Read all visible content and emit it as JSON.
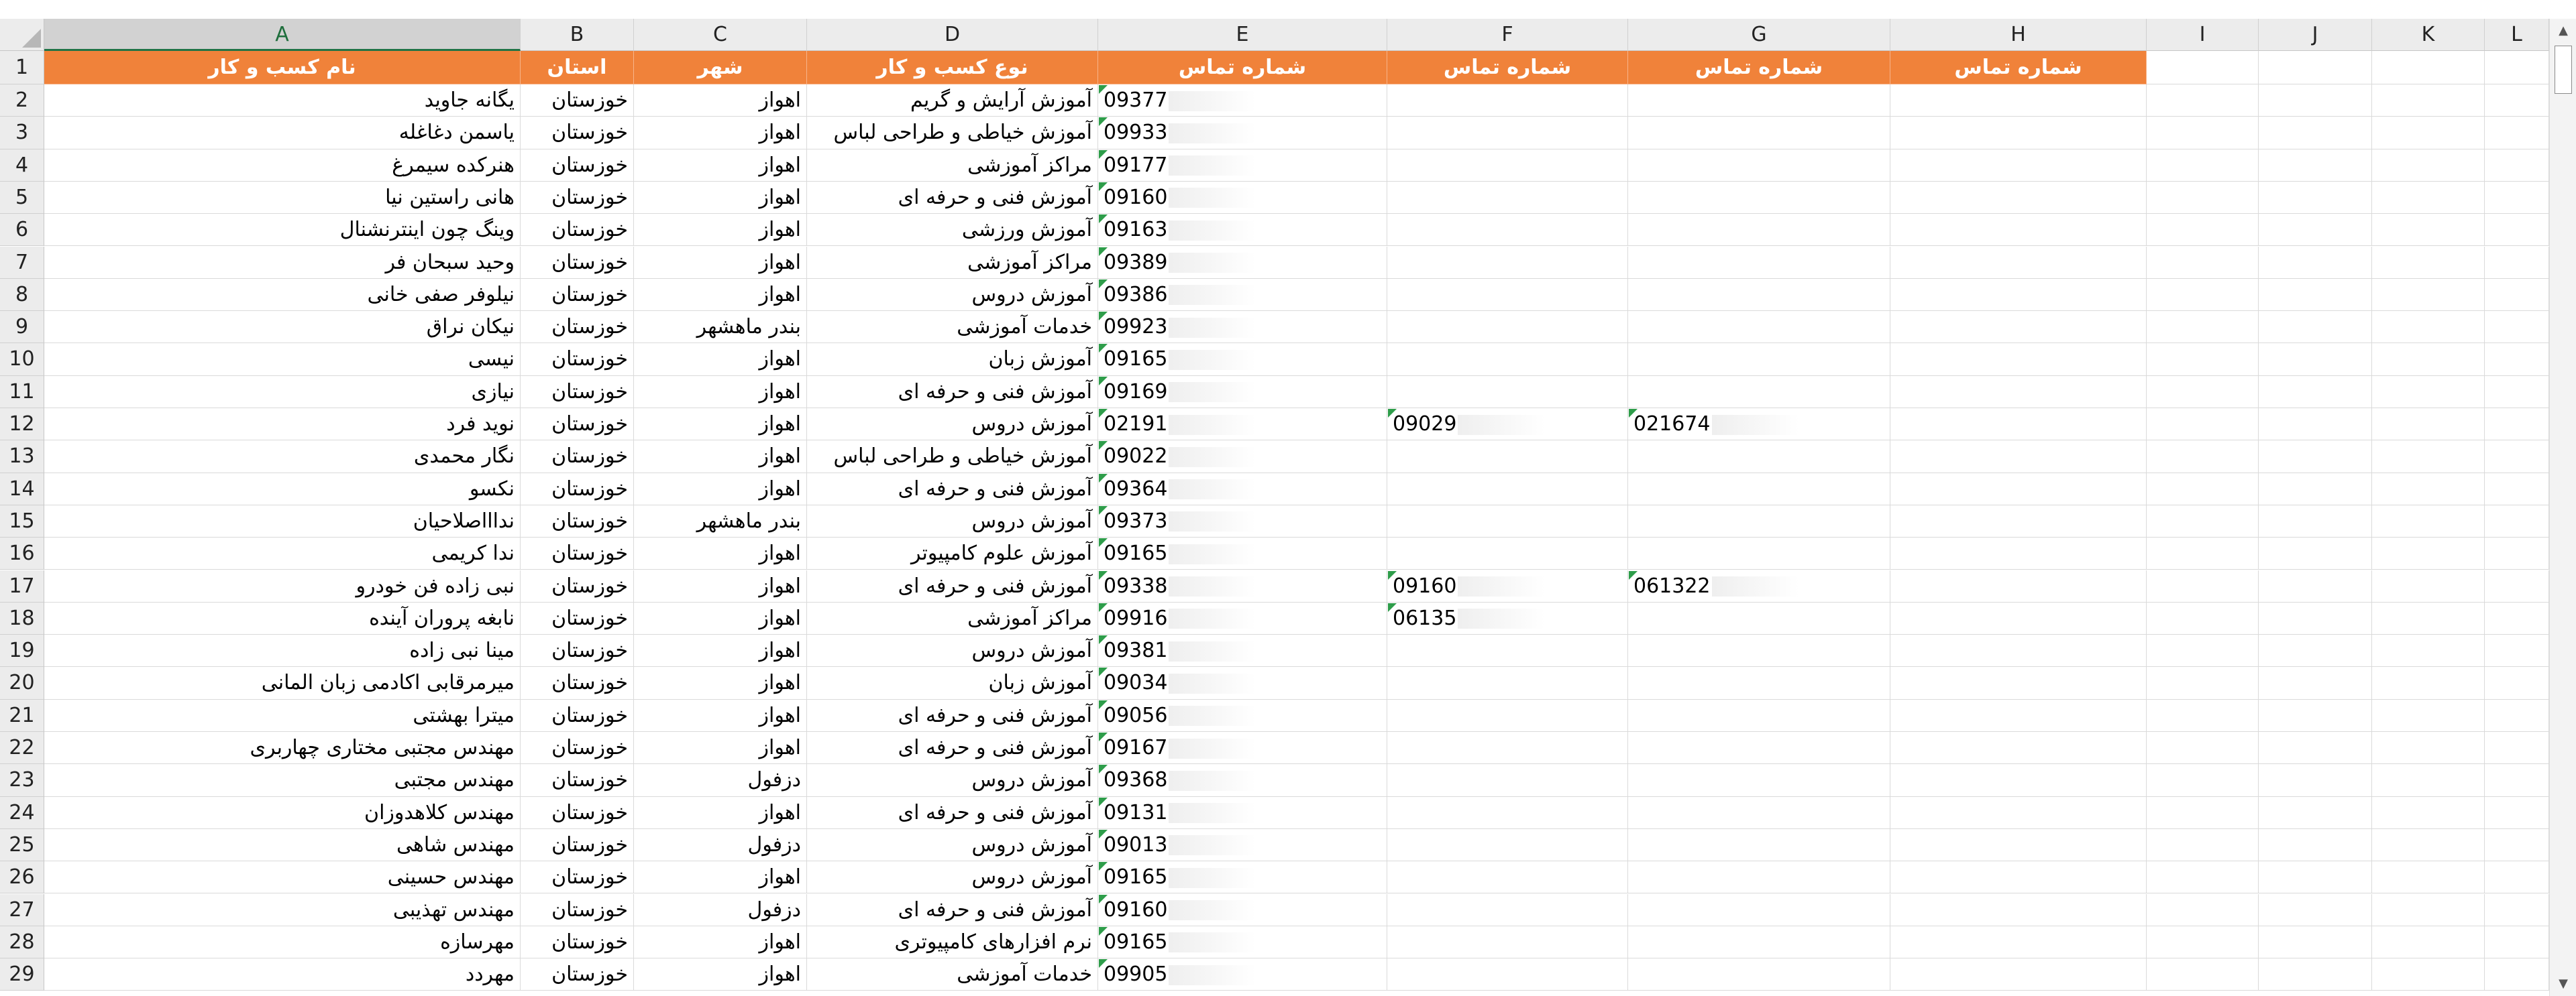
{
  "columns": [
    "A",
    "B",
    "C",
    "D",
    "E",
    "F",
    "G",
    "H",
    "I",
    "J",
    "K",
    "L"
  ],
  "selected_column": "A",
  "header": {
    "business_name": "نام کسب و کار",
    "province": "استان",
    "city": "شهر",
    "business_type": "نوع کسب و کار",
    "contact_1": "شماره تماس",
    "contact_2": "شماره تماس",
    "contact_3": "شماره تماس",
    "contact_4": "شماره تماس"
  },
  "rows": [
    {
      "num": "2",
      "name": "یگانه جاوید",
      "province": "خوزستان",
      "city": "اهواز",
      "type": "آموزش آرایش و گریم",
      "phone": "09377",
      "phone2": "",
      "phone3": ""
    },
    {
      "num": "3",
      "name": "یاسمن دغاغله",
      "province": "خوزستان",
      "city": "اهواز",
      "type": "آموزش خیاطی و طراحی لباس",
      "phone": "09933",
      "phone2": "",
      "phone3": ""
    },
    {
      "num": "4",
      "name": "هنرکده سیمرغ",
      "province": "خوزستان",
      "city": "اهواز",
      "type": "مراکز آموزشی",
      "phone": "09177",
      "phone2": "",
      "phone3": ""
    },
    {
      "num": "5",
      "name": "هانی راستین نیا",
      "province": "خوزستان",
      "city": "اهواز",
      "type": "آموزش فنی و حرفه ای",
      "phone": "09160",
      "phone2": "",
      "phone3": ""
    },
    {
      "num": "6",
      "name": "وینگ چون اینترنشنال",
      "province": "خوزستان",
      "city": "اهواز",
      "type": "آموزش ورزشی",
      "phone": "09163",
      "phone2": "",
      "phone3": ""
    },
    {
      "num": "7",
      "name": "وحید سبحان فر",
      "province": "خوزستان",
      "city": "اهواز",
      "type": "مراکز آموزشی",
      "phone": "09389",
      "phone2": "",
      "phone3": ""
    },
    {
      "num": "8",
      "name": "نیلوفر صفی خانی",
      "province": "خوزستان",
      "city": "اهواز",
      "type": "آموزش دروس",
      "phone": "09386",
      "phone2": "",
      "phone3": ""
    },
    {
      "num": "9",
      "name": "نیکان نراق",
      "province": "خوزستان",
      "city": "بندر ماهشهر",
      "type": "خدمات آموزشی",
      "phone": "09923",
      "phone2": "",
      "phone3": ""
    },
    {
      "num": "10",
      "name": "نیسی",
      "province": "خوزستان",
      "city": "اهواز",
      "type": "آموزش زبان",
      "phone": "09165",
      "phone2": "",
      "phone3": ""
    },
    {
      "num": "11",
      "name": "نیازی",
      "province": "خوزستان",
      "city": "اهواز",
      "type": "آموزش فنی و حرفه ای",
      "phone": "09169",
      "phone2": "",
      "phone3": ""
    },
    {
      "num": "12",
      "name": "نوید فرد",
      "province": "خوزستان",
      "city": "اهواز",
      "type": "آموزش دروس",
      "phone": "02191",
      "phone2": "09029",
      "phone3": "021674"
    },
    {
      "num": "13",
      "name": "نگار محمدی",
      "province": "خوزستان",
      "city": "اهواز",
      "type": "آموزش خیاطی و طراحی لباس",
      "phone": "09022",
      "phone2": "",
      "phone3": ""
    },
    {
      "num": "14",
      "name": "نکسو",
      "province": "خوزستان",
      "city": "اهواز",
      "type": "آموزش فنی و حرفه ای",
      "phone": "09364",
      "phone2": "",
      "phone3": ""
    },
    {
      "num": "15",
      "name": "نداااصلاحیان",
      "province": "خوزستان",
      "city": "بندر ماهشهر",
      "type": "آموزش دروس",
      "phone": "09373",
      "phone2": "",
      "phone3": ""
    },
    {
      "num": "16",
      "name": "ندا کریمی",
      "province": "خوزستان",
      "city": "اهواز",
      "type": "آموزش علوم کامپیوتر",
      "phone": "09165",
      "phone2": "",
      "phone3": ""
    },
    {
      "num": "17",
      "name": "نبی زاده  فن خودرو",
      "province": "خوزستان",
      "city": "اهواز",
      "type": "آموزش فنی و حرفه ای",
      "phone": "09338",
      "phone2": "09160",
      "phone3": "061322"
    },
    {
      "num": "18",
      "name": "نابغه پروران آینده",
      "province": "خوزستان",
      "city": "اهواز",
      "type": "مراکز آموزشی",
      "phone": "09916",
      "phone2": "06135",
      "phone3": ""
    },
    {
      "num": "19",
      "name": "مینا نبی زاده",
      "province": "خوزستان",
      "city": "اهواز",
      "type": "آموزش دروس",
      "phone": "09381",
      "phone2": "",
      "phone3": ""
    },
    {
      "num": "20",
      "name": "میرمرقابی اکادمی زبان المانی",
      "province": "خوزستان",
      "city": "اهواز",
      "type": "آموزش زبان",
      "phone": "09034",
      "phone2": "",
      "phone3": ""
    },
    {
      "num": "21",
      "name": "میترا بهشتی",
      "province": "خوزستان",
      "city": "اهواز",
      "type": "آموزش فنی و حرفه ای",
      "phone": "09056",
      "phone2": "",
      "phone3": ""
    },
    {
      "num": "22",
      "name": "مهندس مجتبی مختاری چهاربری",
      "province": "خوزستان",
      "city": "اهواز",
      "type": "آموزش فنی و حرفه ای",
      "phone": "09167",
      "phone2": "",
      "phone3": ""
    },
    {
      "num": "23",
      "name": "مهندس مجتبی",
      "province": "خوزستان",
      "city": "دزفول",
      "type": "آموزش دروس",
      "phone": "09368",
      "phone2": "",
      "phone3": ""
    },
    {
      "num": "24",
      "name": "مهندس کلاهدوزان",
      "province": "خوزستان",
      "city": "اهواز",
      "type": "آموزش فنی و حرفه ای",
      "phone": "09131",
      "phone2": "",
      "phone3": ""
    },
    {
      "num": "25",
      "name": "مهندس شاهی",
      "province": "خوزستان",
      "city": "دزفول",
      "type": "آموزش دروس",
      "phone": "09013",
      "phone2": "",
      "phone3": ""
    },
    {
      "num": "26",
      "name": "مهندس حسینی",
      "province": "خوزستان",
      "city": "اهواز",
      "type": "آموزش دروس",
      "phone": "09165",
      "phone2": "",
      "phone3": ""
    },
    {
      "num": "27",
      "name": "مهندس تهذیبی",
      "province": "خوزستان",
      "city": "دزفول",
      "type": "آموزش فنی و حرفه ای",
      "phone": "09160",
      "phone2": "",
      "phone3": ""
    },
    {
      "num": "28",
      "name": "مهرسازه",
      "province": "خوزستان",
      "city": "اهواز",
      "type": "نرم افزارهای کامپیوتری",
      "phone": "09165",
      "phone2": "",
      "phone3": ""
    },
    {
      "num": "29",
      "name": "مهردد",
      "province": "خوزستان",
      "city": "اهواز",
      "type": "خدمات آموزشی",
      "phone": "09905",
      "phone2": "",
      "phone3": ""
    }
  ],
  "colors": {
    "header_fill": "#f0823a",
    "header_text": "#ffffff",
    "comment_marker": "#2e9d4a",
    "selected_header": "#217346"
  }
}
